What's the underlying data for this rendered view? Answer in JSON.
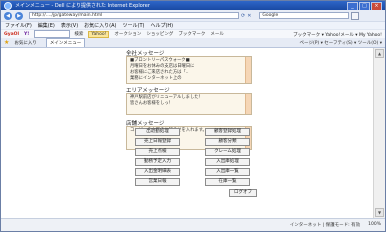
{
  "window": {
    "title": "メインメニュー - Dell により提供された Internet Explorer",
    "buttons": [
      "_",
      "□",
      "×"
    ]
  },
  "address": {
    "url": "http://..../jp/gateway/main.html",
    "search_text": "Google"
  },
  "menubar": [
    "ファイル(F)",
    "編集(E)",
    "表示(V)",
    "お気に入り(A)",
    "ツール(T)",
    "ヘルプ(H)"
  ],
  "toolbar": {
    "brand": "GyaOl",
    "yahoo": "Y!",
    "search_btn": "検索",
    "highlight": "Yahoo!",
    "items": [
      "オークション",
      "ショッピング",
      "ブックマーク",
      "メール"
    ],
    "right": "ブックマーク ▾  Yahoo!メール ▾  My Yahoo!"
  },
  "tabs": {
    "fav_label": "お気に入り",
    "active": "メインメニュー",
    "right": "ページ(P) ▾  セーフティ(S) ▾  ツール(O) ▾"
  },
  "content": {
    "section1": {
      "label": "全社メッセージ",
      "lines": [
        "■ブロントリーパスウォーク■",
        "",
        "月曜日をお休みの支店は日曜日に",
        "お客様にご来店された方は「..",
        "業務にインターネット上の"
      ]
    },
    "section2": {
      "label": "エリアメッセージ",
      "lines": [
        "神戸駅前店がリニューアルしました！",
        "皆さんお客様をしっ！"
      ]
    },
    "section3": {
      "label": "店舗メッセージ",
      "lines": [
        "コンビニの本日のお知らせを入れます。"
      ]
    },
    "buttons": [
      "出退勤処理",
      "顧客登録処理",
      "売上日報登録",
      "顧客分類",
      "売上点検",
      "クレーム処理",
      "勤務予定入力",
      "入出庫処理",
      "入出金明細表",
      "入出庫一覧",
      "営業日報",
      "在庫一覧"
    ],
    "logout_label": "ログオフ"
  },
  "status": {
    "left": "",
    "zone": "インターネット | 保護モード: 有効",
    "zoom": "100%"
  }
}
